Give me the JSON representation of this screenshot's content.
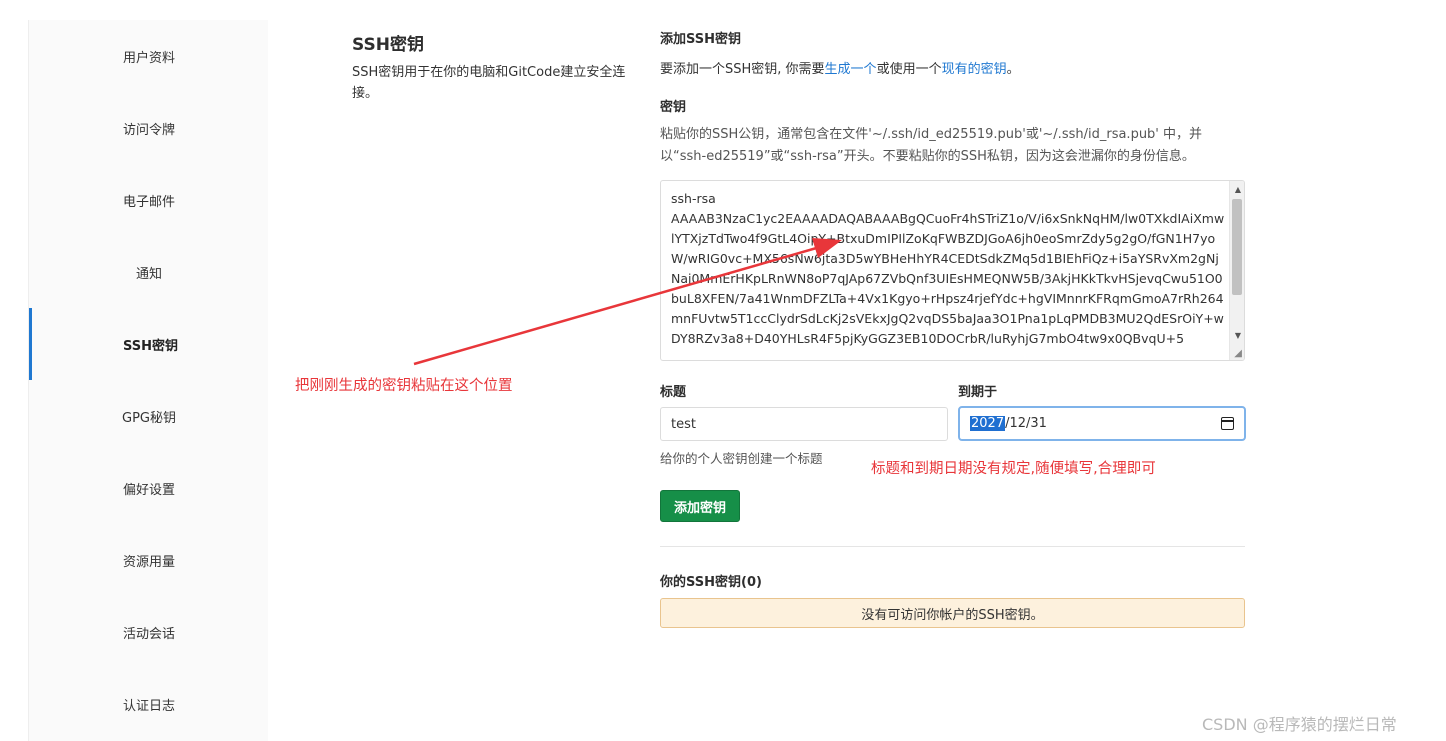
{
  "sidebar": {
    "items": [
      {
        "label": "用户资料"
      },
      {
        "label": "访问令牌"
      },
      {
        "label": "电子邮件"
      },
      {
        "label": "通知"
      },
      {
        "label": "SSH密钥"
      },
      {
        "label": "GPG秘钥"
      },
      {
        "label": "偏好设置"
      },
      {
        "label": "资源用量"
      },
      {
        "label": "活动会话"
      },
      {
        "label": "认证日志"
      }
    ],
    "active_index": 4,
    "active_color": "#1f78d1"
  },
  "section": {
    "title": "SSH密钥",
    "description": "SSH密钥用于在你的电脑和GitCode建立安全连接。"
  },
  "form": {
    "add_heading": "添加SSH密钥",
    "intro_prefix": "要添加一个SSH密钥, 你需要",
    "intro_link_generate": "生成一个",
    "intro_middle": "或使用一个",
    "intro_link_existing": "现有的密钥",
    "intro_suffix": "。",
    "key_label": "密钥",
    "key_help": "粘贴你的SSH公钥，通常包含在文件'~/.ssh/id_ed25519.pub'或'~/.ssh/id_rsa.pub' 中，并以“ssh-ed25519”或“ssh-rsa”开头。不要粘贴你的SSH私钥，因为这会泄漏你的身份信息。",
    "key_value": "ssh-rsa\nAAAAB3NzaC1yc2EAAAADAQABAAABgQCuoFr4hSTriZ1o/V/i6xSnkNqHM/lw0TXkdIAiXmwlYTXjzTdTwo4f9GtL4OipY+BtxuDmIPIlZoKqFWBZDJGoA6jh0eoSmrZdy5g2gO/fGN1H7yoW/wRIG0vc+MX56sNw6jta3D5wYBHeHhYR4CEDtSdkZMq5d1BIEhFiQz+i5aYSRvXm2gNjNaj0MmErHKpLRnWN8oP7qJAp67ZVbQnf3UIEsHMEQNW5B/3AkjHKkTkvHSjevqCwu51O0buL8XFEN/7a41WnmDFZLTa+4Vx1Kgyo+rHpsz4rjefYdc+hgVIMnnrKFRqmGmoA7rRh264mnFUvtw5T1ccClydrSdLcKj2sVEkxJgQ2vqDS5baJaa3O1Pna1pLqPMDB3MU2QdESrOiY+wDY8RZv3a8+D40YHLsR4F5pjKyGGZ3EB10DOCrbR/luRyhjG7mbO4tw9x0QBvqU+5",
    "title_label": "标题",
    "title_value": "test",
    "title_help": "给你的个人密钥创建一个标题",
    "expiry_label": "到期于",
    "expiry_year": "2027",
    "expiry_rest": "/12/31",
    "add_button_label": "添加密钥",
    "button_color": "#168f48"
  },
  "keys": {
    "heading": "你的SSH密钥(0)",
    "empty_message": "没有可访问你帐户的SSH密钥。"
  },
  "annotations": {
    "paste_hint": "把刚刚生成的密钥粘贴在这个位置",
    "title_hint": "标题和到期日期没有规定,随便填写,合理即可",
    "color": "#e8363a"
  },
  "watermark": "CSDN @程序猿的摆烂日常"
}
